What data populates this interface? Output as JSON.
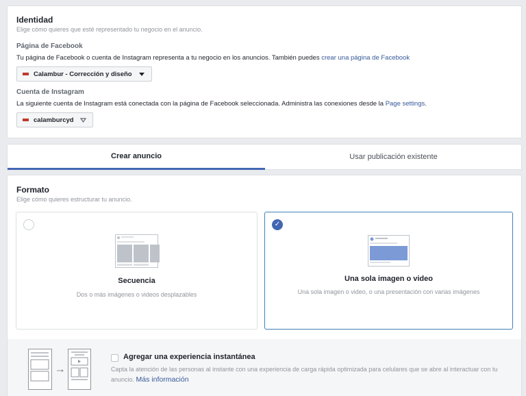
{
  "identity": {
    "title": "Identidad",
    "subtitle": "Elige cómo quieres que esté representado tu negocio en el anuncio.",
    "facebook_page": {
      "heading": "Página de Facebook",
      "description": "Tu página de Facebook o cuenta de Instagram representa a tu negocio en los anuncios. También puedes",
      "link": "crear una página de Facebook",
      "selected": "Calambur - Corrección y diseño"
    },
    "instagram": {
      "heading": "Cuenta de Instagram",
      "description": "La siguiente cuenta de Instagram está conectada con la página de Facebook seleccionada. Administra las conexiones desde la",
      "link": "Page settings",
      "period": ".",
      "selected": "calamburcyd"
    }
  },
  "tabs": {
    "create": "Crear anuncio",
    "existing": "Usar publicación existente"
  },
  "format": {
    "title": "Formato",
    "subtitle": "Elige cómo quieres estructurar tu anuncio.",
    "options": [
      {
        "title": "Secuencia",
        "desc": "Dos o más imágenes o videos desplazables",
        "selected": false
      },
      {
        "title": "Una sola imagen o video",
        "desc": "Una sola imagen o video, o una presentación con varias imágenes",
        "selected": true
      }
    ]
  },
  "instant": {
    "title": "Agregar una experiencia instantánea",
    "desc": "Capta la atención de las personas al instante con una experiencia de carga rápida optimizada para celulares que se abre al interactuar con tu anuncio.",
    "link": "Más información"
  },
  "colors": {
    "accent": "#4267b2",
    "link": "#365899",
    "tab_underline": "#4267b2"
  }
}
